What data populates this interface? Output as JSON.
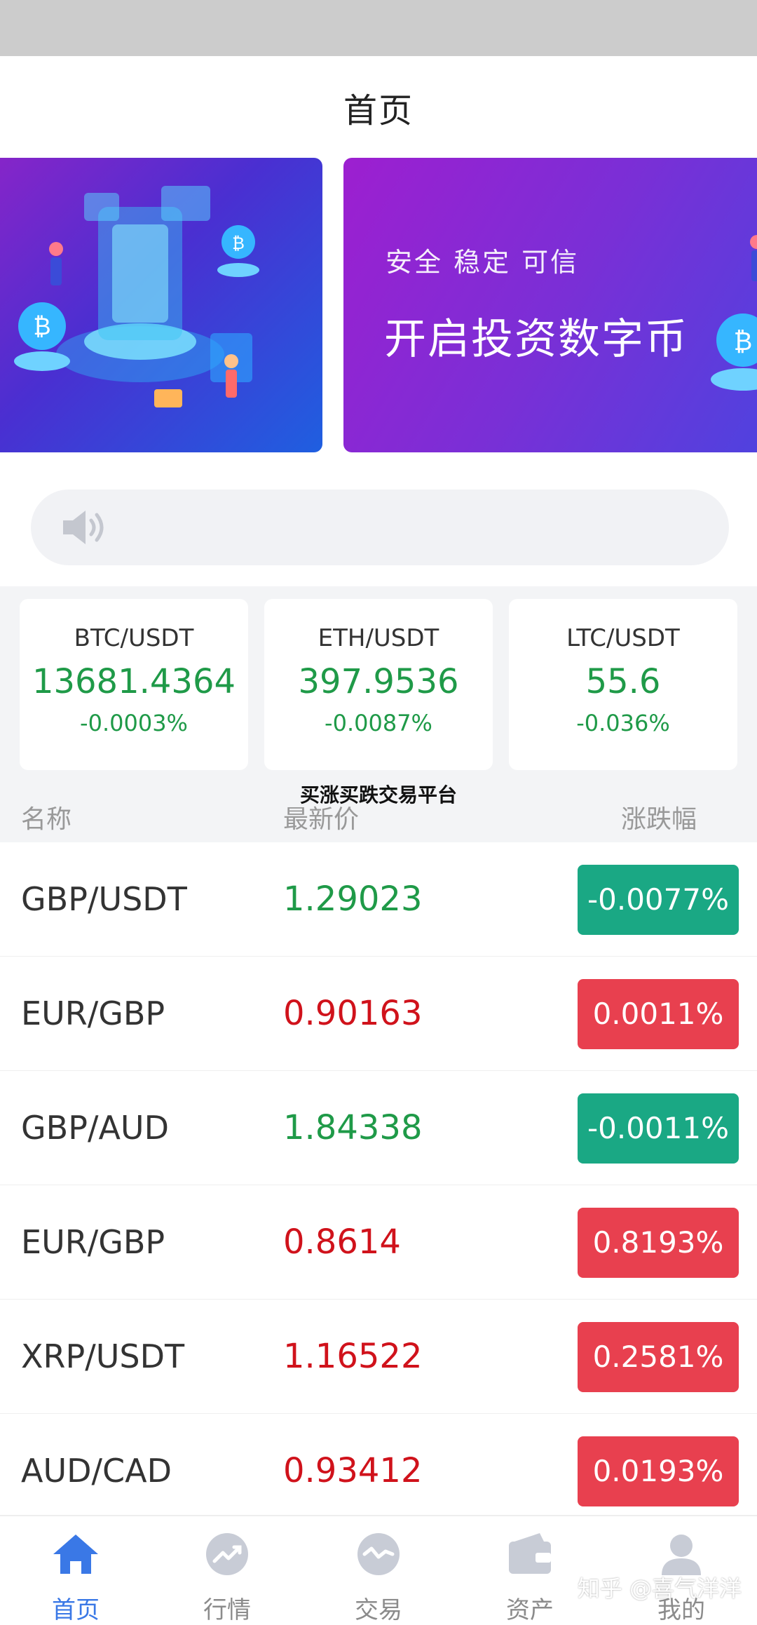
{
  "navbar": {
    "title": "首页"
  },
  "banner": {
    "tagline": "安全 稳定 可信",
    "headline": "开启投资数字币"
  },
  "notice": {
    "icon": "speaker-icon",
    "text": ""
  },
  "tickers": [
    {
      "pair": "BTC/USDT",
      "price": "13681.4364",
      "change": "-0.0003%"
    },
    {
      "pair": "ETH/USDT",
      "price": "397.9536",
      "change": "-0.0087%"
    },
    {
      "pair": "LTC/USDT",
      "price": "55.6",
      "change": "-0.036%"
    }
  ],
  "list_header": {
    "name": "名称",
    "price": "最新价",
    "change": "涨跌幅",
    "overlay_text": "买涨买跌交易平台"
  },
  "rows": [
    {
      "name": "GBP/USDT",
      "price": "1.29023",
      "change": "-0.0077%",
      "trend": "down"
    },
    {
      "name": "EUR/GBP",
      "price": "0.90163",
      "change": "0.0011%",
      "trend": "up"
    },
    {
      "name": "GBP/AUD",
      "price": "1.84338",
      "change": "-0.0011%",
      "trend": "down"
    },
    {
      "name": "EUR/GBP",
      "price": "0.8614",
      "change": "0.8193%",
      "trend": "up"
    },
    {
      "name": "XRP/USDT",
      "price": "1.16522",
      "change": "0.2581%",
      "trend": "up"
    },
    {
      "name": "AUD/CAD",
      "price": "0.93412",
      "change": "0.0193%",
      "trend": "up"
    }
  ],
  "tabbar": {
    "items": [
      {
        "label": "首页",
        "icon": "home-icon",
        "active": true
      },
      {
        "label": "行情",
        "icon": "chart-trend-icon",
        "active": false
      },
      {
        "label": "交易",
        "icon": "exchange-icon",
        "active": false
      },
      {
        "label": "资产",
        "icon": "wallet-icon",
        "active": false
      },
      {
        "label": "我的",
        "icon": "user-icon",
        "active": false
      }
    ]
  },
  "watermark": "知乎 @喜气洋洋",
  "colors": {
    "up_price": "#d0121b",
    "down_price": "#1f9a48",
    "up_badge": "#e8404f",
    "down_badge": "#1aa884",
    "active_tab": "#3a78e6",
    "inactive_tab": "#c8ccd6"
  }
}
